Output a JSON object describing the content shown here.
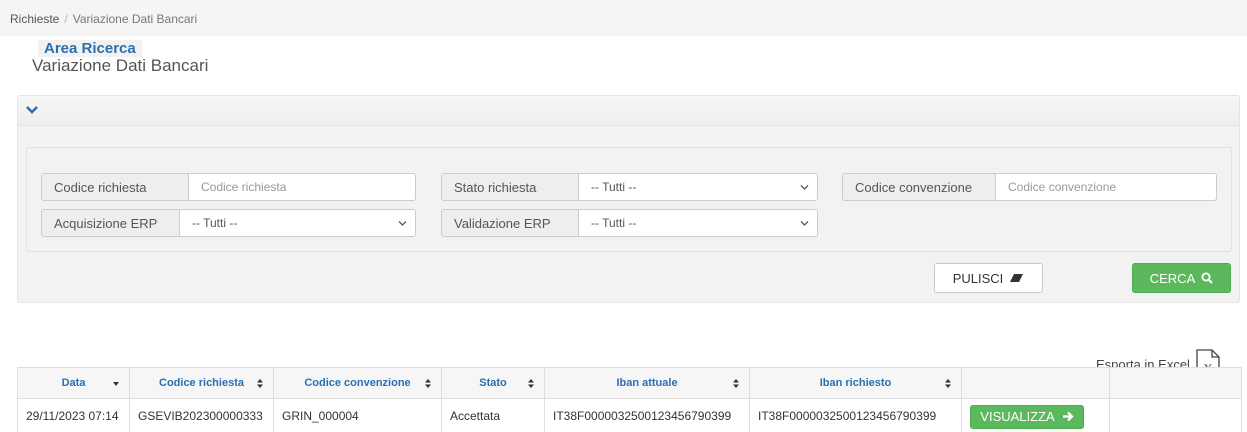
{
  "breadcrumb": {
    "parent": "Richieste",
    "separator": "/",
    "current": "Variazione Dati Bancari"
  },
  "page_title": "Variazione Dati Bancari",
  "search_panel": {
    "legend": "Area Ricerca",
    "fields": {
      "codice_richiesta": {
        "label": "Codice richiesta",
        "placeholder": "Codice richiesta"
      },
      "stato_richiesta": {
        "label": "Stato richiesta",
        "value": "-- Tutti --"
      },
      "codice_convenzione": {
        "label": "Codice convenzione",
        "placeholder": "Codice convenzione"
      },
      "acquisizione_erp": {
        "label": "Acquisizione ERP",
        "value": "-- Tutti --"
      },
      "validazione_erp": {
        "label": "Validazione ERP",
        "value": "-- Tutti --"
      }
    },
    "clear_button": "PULISCI",
    "search_button": "CERCA"
  },
  "export_label": "Esporta in Excel",
  "table": {
    "headers": [
      "Data",
      "Codice richiesta",
      "Codice convenzione",
      "Stato",
      "Iban attuale",
      "Iban richiesto",
      "",
      ""
    ],
    "rows": [
      {
        "data": "29/11/2023 07:14",
        "codice_richiesta": "GSEVIB202300000333",
        "codice_convenzione": "GRIN_000004",
        "stato": "Accettata",
        "iban_attuale": "IT38F0000032500123456790399",
        "iban_richiesto": "IT38F0000032500123456790399",
        "action": "VISUALIZZA"
      }
    ]
  },
  "colors": {
    "accent_blue": "#2a6fb0",
    "success_green": "#5cb85c"
  }
}
